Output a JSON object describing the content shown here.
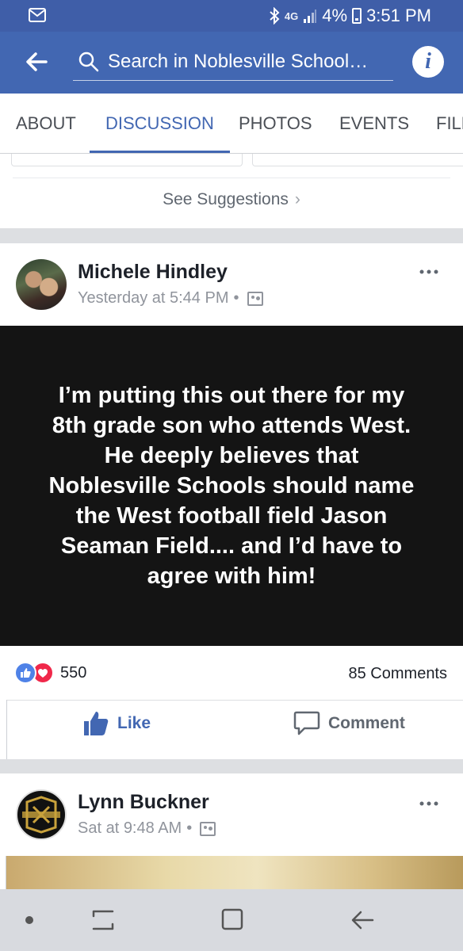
{
  "status_bar": {
    "network": "4G",
    "battery": "4%",
    "time": "3:51 PM"
  },
  "app_bar": {
    "search_placeholder": "Search in Noblesville School…"
  },
  "tabs": [
    {
      "label": "ABOUT"
    },
    {
      "label": "DISCUSSION",
      "active": true
    },
    {
      "label": "PHOTOS"
    },
    {
      "label": "EVENTS"
    },
    {
      "label": "FILES"
    }
  ],
  "suggestions": {
    "label": "See Suggestions"
  },
  "post1": {
    "author": "Michele Hindley",
    "timestamp": "Yesterday at 5:44 PM",
    "separator": "•",
    "text": "I’m putting this out there for my\n8th grade son who attends West.\nHe deeply believes that\nNoblesville Schools should name\nthe West football field Jason\nSeaman Field....  and I’d have to\nagree with him!",
    "reaction_count": "550",
    "comment_count": "85 Comments",
    "like_label": "Like",
    "comment_label": "Comment"
  },
  "post2": {
    "author": "Lynn Buckner",
    "timestamp": "Sat at 9:48 AM",
    "separator": "•"
  },
  "colors": {
    "brand_blue": "#4267b2",
    "status_blue": "#3f5ea8",
    "love_red": "#f0284a"
  },
  "icons": {
    "back": "arrow-left-icon",
    "search": "search-icon",
    "info": "info-icon",
    "like": "thumbs-up-icon",
    "comment": "comment-bubble-icon",
    "more": "more-dots-icon"
  }
}
